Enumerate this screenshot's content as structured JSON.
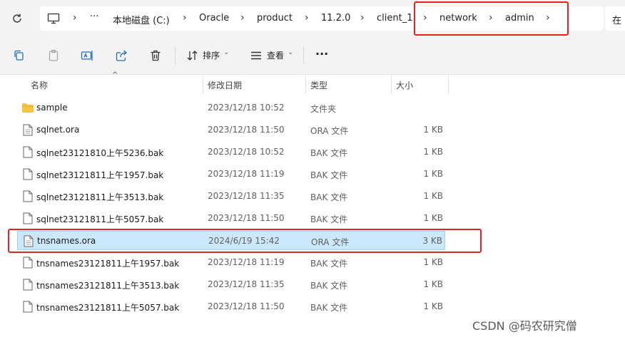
{
  "breadcrumb": {
    "items": [
      "本地磁盘 (C:)",
      "Oracle",
      "product",
      "11.2.0",
      "client_1",
      "network",
      "admin"
    ],
    "overflow_label": "···",
    "right_search_hint": "在"
  },
  "toolbar": {
    "sort_label": "排序",
    "view_label": "查看",
    "more_label": "···"
  },
  "columns": {
    "name": "名称",
    "date": "修改日期",
    "type": "类型",
    "size": "大小"
  },
  "files": [
    {
      "name": "sample",
      "date": "2023/12/18 10:52",
      "type": "文件夹",
      "size": "",
      "kind": "folder"
    },
    {
      "name": "sqlnet.ora",
      "date": "2023/12/18 11:50",
      "type": "ORA 文件",
      "size": "1 KB",
      "kind": "file"
    },
    {
      "name": "sqlnet23121810上午5236.bak",
      "date": "2023/12/18 10:52",
      "type": "BAK 文件",
      "size": "1 KB",
      "kind": "file"
    },
    {
      "name": "sqlnet23121811上午1957.bak",
      "date": "2023/12/18 11:19",
      "type": "BAK 文件",
      "size": "1 KB",
      "kind": "file"
    },
    {
      "name": "sqlnet23121811上午3513.bak",
      "date": "2023/12/18 11:35",
      "type": "BAK 文件",
      "size": "1 KB",
      "kind": "file"
    },
    {
      "name": "sqlnet23121811上午5057.bak",
      "date": "2023/12/18 11:50",
      "type": "BAK 文件",
      "size": "1 KB",
      "kind": "file"
    },
    {
      "name": "tnsnames.ora",
      "date": "2024/6/19 15:42",
      "type": "ORA 文件",
      "size": "3 KB",
      "kind": "file",
      "selected": true
    },
    {
      "name": "tnsnames23121811上午1957.bak",
      "date": "2023/12/18 11:19",
      "type": "BAK 文件",
      "size": "1 KB",
      "kind": "file"
    },
    {
      "name": "tnsnames23121811上午3513.bak",
      "date": "2023/12/18 11:35",
      "type": "BAK 文件",
      "size": "1 KB",
      "kind": "file"
    },
    {
      "name": "tnsnames23121811上午5057.bak",
      "date": "2023/12/18 11:50",
      "type": "BAK 文件",
      "size": "1 KB",
      "kind": "file"
    }
  ],
  "watermark": "CSDN @码农研究僧",
  "colors": {
    "selection_bg": "#cce8ff",
    "highlight_box": "#e8201f",
    "folder": "#f6c344"
  }
}
